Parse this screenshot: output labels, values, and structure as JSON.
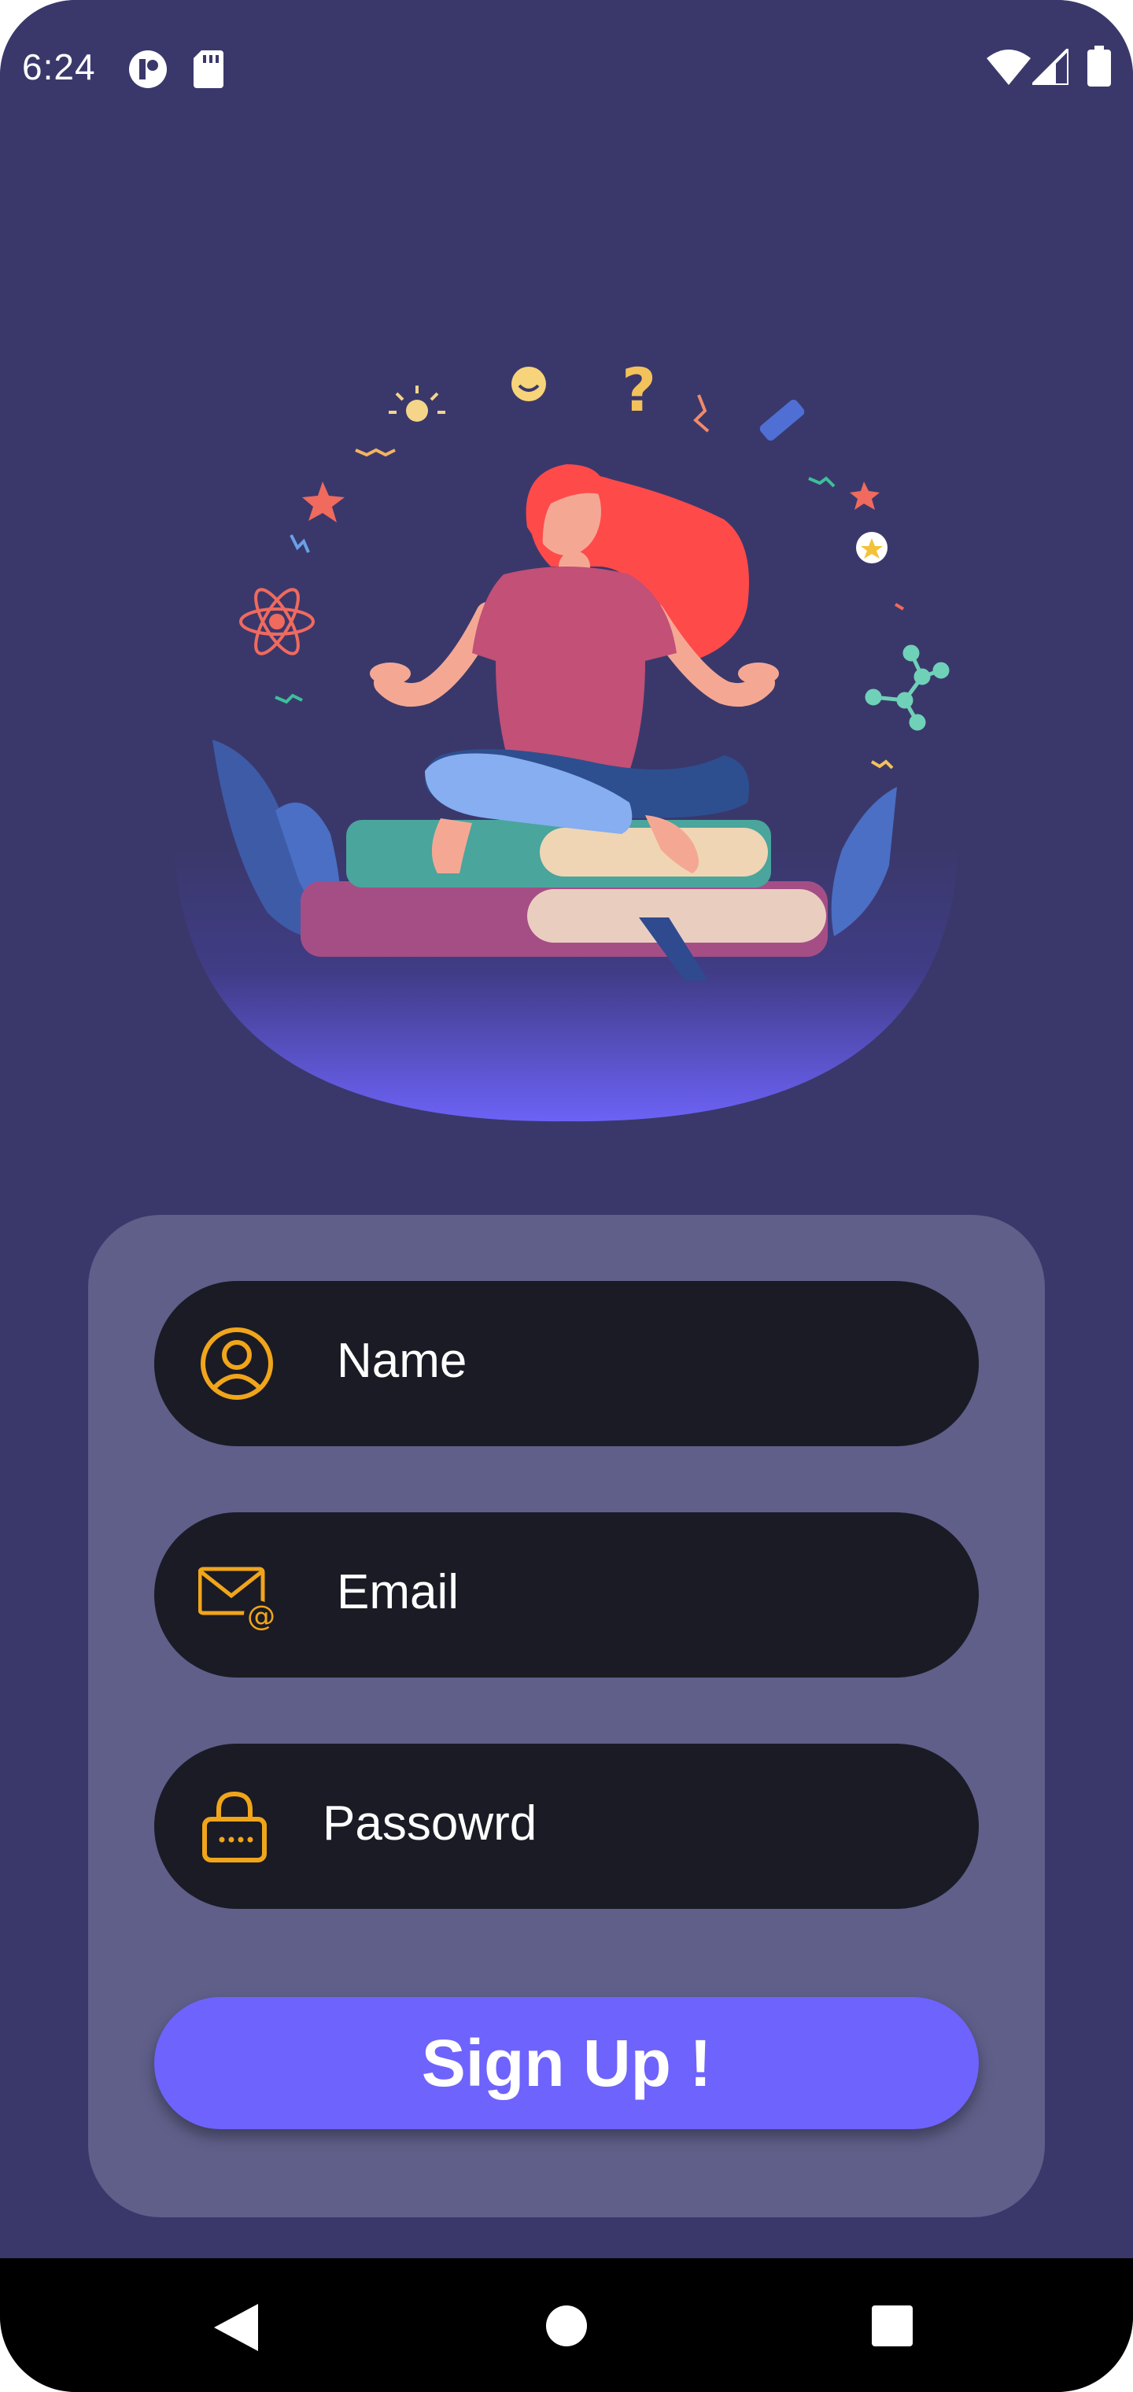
{
  "status_bar": {
    "time": "6:24",
    "icons": [
      "app-notification-icon",
      "sd-card-icon",
      "wifi-icon",
      "cellular-signal-icon",
      "battery-icon"
    ]
  },
  "hero": {
    "illustration": "woman-meditating-on-books-illustration"
  },
  "form": {
    "name_label": "Name",
    "email_label": "Email",
    "password_label": "Passowrd",
    "signup_label": "Sign Up !"
  },
  "navigation": {
    "back": "back-icon",
    "home": "home-icon",
    "recents": "recents-icon"
  },
  "colors": {
    "background": "#3a386b",
    "card": "#5f5f8a",
    "field": "#1b1b25",
    "accent": "#6e63fc",
    "icon": "#f0a51a"
  }
}
